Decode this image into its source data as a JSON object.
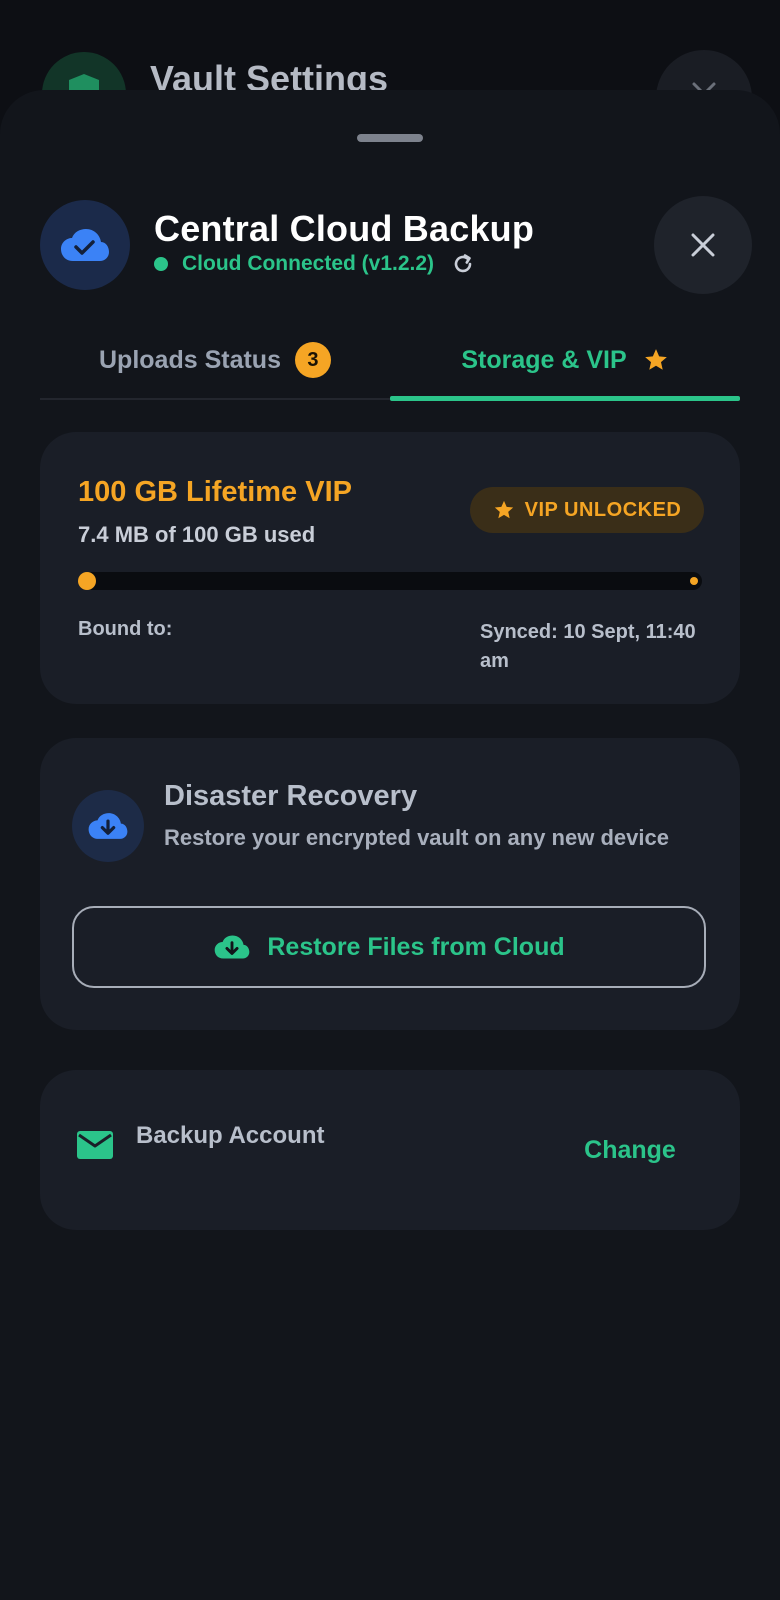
{
  "background": {
    "title": "Vault Settings",
    "icons": {
      "shield": "shield-icon",
      "close": "close-icon"
    }
  },
  "sheet": {
    "title": "Central Cloud Backup",
    "status_text": "Cloud Connected (v1.2.2)",
    "icons": {
      "header": "cloud-check-icon",
      "refresh": "refresh-icon",
      "close": "close-icon"
    }
  },
  "tabs": [
    {
      "label": "Uploads Status",
      "badge": "3",
      "active": false
    },
    {
      "label": "Storage & VIP",
      "icon": "star-icon",
      "active": true
    }
  ],
  "storage_card": {
    "plan_title": "100 GB Lifetime VIP",
    "usage_text": "7.4 MB of 100 GB used",
    "vip_badge": "VIP UNLOCKED",
    "usage_fraction": 7.4e-05,
    "bound_label": "Bound to:",
    "synced_text": "Synced: 10 Sept, 11:40 am"
  },
  "recovery_card": {
    "title": "Disaster Recovery",
    "description": "Restore your encrypted vault on any new device",
    "restore_button": "Restore Files from Cloud",
    "icons": {
      "main": "cloud-download-icon",
      "button": "cloud-download-icon"
    }
  },
  "account_card": {
    "label": "Backup Account",
    "change_button": "Change",
    "icon": "mail-icon"
  },
  "colors": {
    "accent_green": "#2bc48a",
    "accent_orange": "#f5a524",
    "accent_blue": "#3b82f6",
    "background": "#0d0f14",
    "sheet": "#12151b",
    "card": "#1a1e27"
  }
}
